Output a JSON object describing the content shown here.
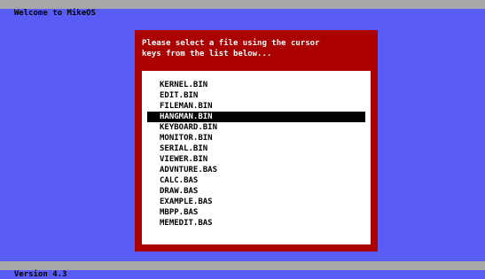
{
  "window": {
    "title": "Welcome to MikeOS",
    "version": "Version 4.3"
  },
  "dialog": {
    "prompt": "Please select a file using the cursor\nkeys from the list below...",
    "files": [
      {
        "name": "KERNEL.BIN",
        "selected": false
      },
      {
        "name": "EDIT.BIN",
        "selected": false
      },
      {
        "name": "FILEMAN.BIN",
        "selected": false
      },
      {
        "name": "HANGMAN.BIN",
        "selected": true
      },
      {
        "name": "KEYBOARD.BIN",
        "selected": false
      },
      {
        "name": "MONITOR.BIN",
        "selected": false
      },
      {
        "name": "SERIAL.BIN",
        "selected": false
      },
      {
        "name": "VIEWER.BIN",
        "selected": false
      },
      {
        "name": "ADVNTURE.BAS",
        "selected": false
      },
      {
        "name": "CALC.BAS",
        "selected": false
      },
      {
        "name": "DRAW.BAS",
        "selected": false
      },
      {
        "name": "EXAMPLE.BAS",
        "selected": false
      },
      {
        "name": "MBPP.BAS",
        "selected": false
      },
      {
        "name": "MEMEDIT.BAS",
        "selected": false
      }
    ]
  },
  "colors": {
    "background": "#5a5cf6",
    "bar": "#a8a8a8",
    "dialog": "#aa0000",
    "list_bg": "#ffffff",
    "selection": "#000000"
  }
}
